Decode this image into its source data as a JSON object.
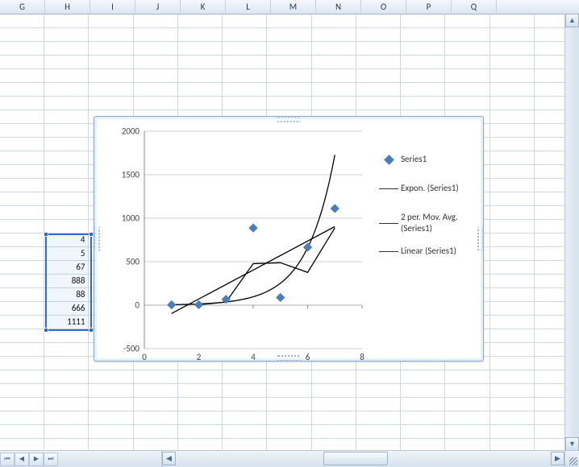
{
  "columns": [
    "G",
    "H",
    "I",
    "J",
    "K",
    "L",
    "M",
    "N",
    "O",
    "P",
    "Q"
  ],
  "selected_range": {
    "col_start": 1,
    "row_start": 16,
    "rows": 7
  },
  "cells": {
    "H17": "4",
    "H18": "5",
    "H19": "67",
    "H20": "888",
    "H21": "88",
    "H22": "666",
    "H23": "1111"
  },
  "chart_data": {
    "type": "scatter",
    "x": [
      1,
      2,
      3,
      4,
      5,
      6,
      7
    ],
    "series": [
      {
        "name": "Series1",
        "kind": "points",
        "values": [
          4,
          5,
          67,
          888,
          88,
          666,
          1111
        ]
      },
      {
        "name": "Expon. (Series1)",
        "kind": "trend-exponential"
      },
      {
        "name": "2 per. Mov. Avg. (Series1)",
        "kind": "trend-moving-avg",
        "period": 2
      },
      {
        "name": "Linear (Series1)",
        "kind": "trend-linear"
      }
    ],
    "xlim": [
      0,
      8
    ],
    "ylim": [
      -500,
      2000
    ],
    "yticks": [
      -500,
      0,
      500,
      1000,
      1500,
      2000
    ],
    "xticks": [
      0,
      2,
      4,
      6,
      8
    ],
    "title": "",
    "xlabel": "",
    "ylabel": ""
  },
  "legend": {
    "items": [
      "Series1",
      "Expon. (Series1)",
      "2 per. Mov. Avg. (Series1)",
      "Linear (Series1)"
    ]
  }
}
